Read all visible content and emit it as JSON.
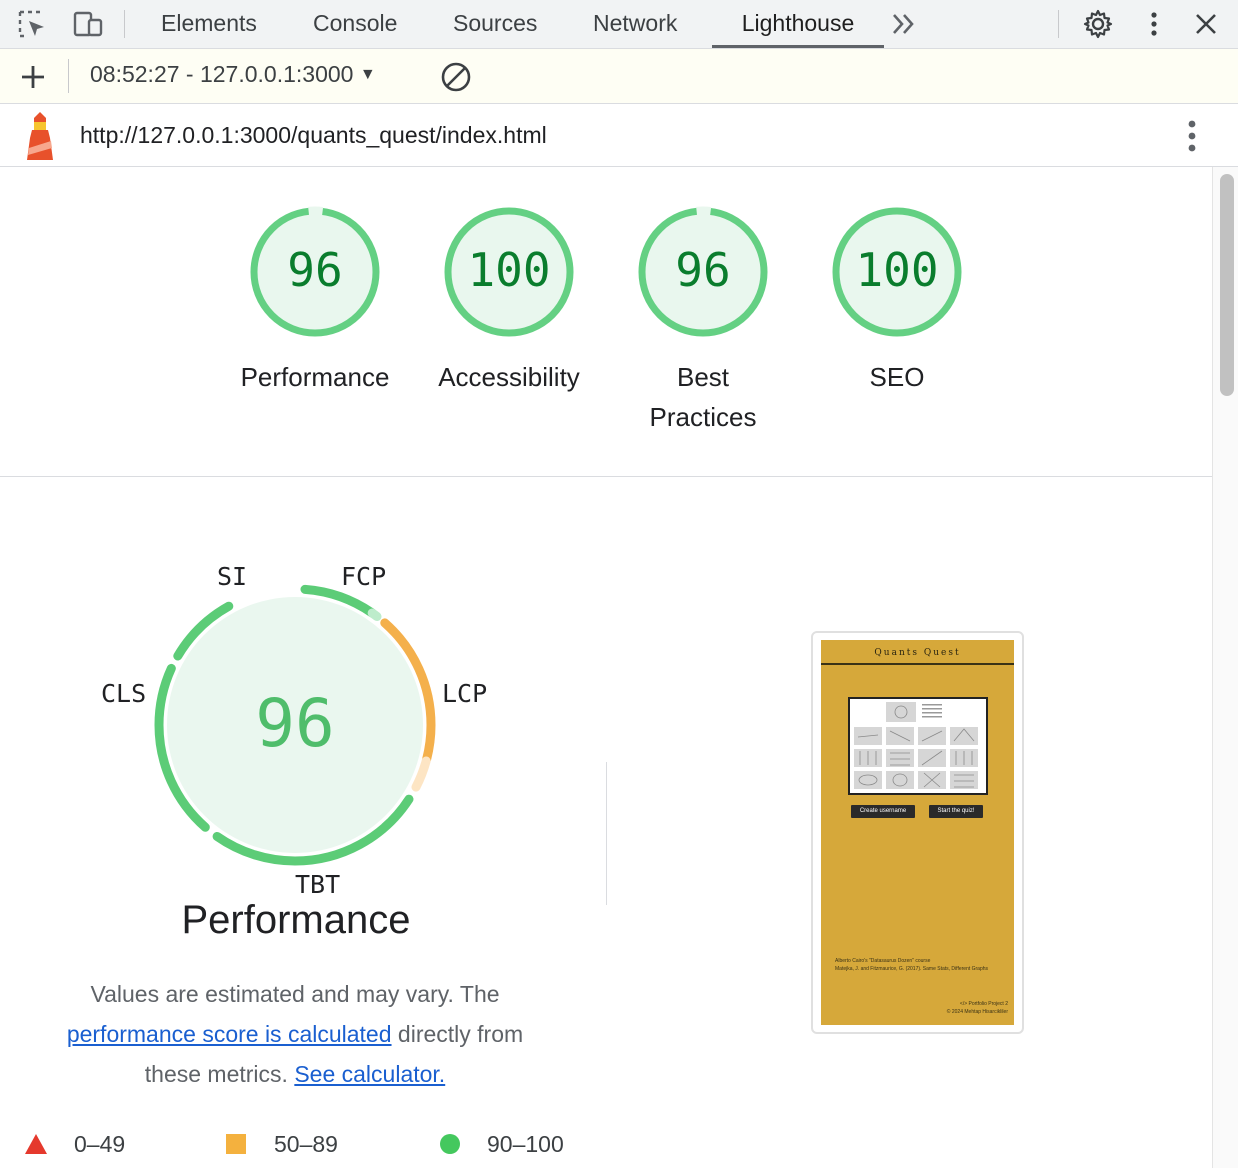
{
  "devtools": {
    "tabs": [
      {
        "label": "Elements"
      },
      {
        "label": "Console"
      },
      {
        "label": "Sources"
      },
      {
        "label": "Network"
      },
      {
        "label": "Lighthouse",
        "active": true
      }
    ]
  },
  "toolbar": {
    "report_selector": "08:52:27 - 127.0.0.1:3000"
  },
  "report": {
    "url": "http://127.0.0.1:3000/quants_quest/index.html"
  },
  "gauges": [
    {
      "label": "Performance",
      "score": "96"
    },
    {
      "label": "Accessibility",
      "score": "100"
    },
    {
      "label": "Best Practices",
      "score": "96"
    },
    {
      "label": "SEO",
      "score": "100"
    }
  ],
  "performance": {
    "score": "96",
    "title": "Performance",
    "metrics": {
      "si": "SI",
      "fcp": "FCP",
      "lcp": "LCP",
      "tbt": "TBT",
      "cls": "CLS"
    },
    "desc_part1": "Values are estimated and may vary. The",
    "desc_link1": "performance score is calculated",
    "desc_part2": "directly from",
    "desc_part3": "these metrics.",
    "desc_link2": "See calculator."
  },
  "screenshot": {
    "title": "Quants Quest",
    "button1": "Create username",
    "button2": "Start the quiz!",
    "footer1": "Alberto Cairo's \"Datasaurus Dozen\" course",
    "footer2": "Matejka, J. and Fitzmaurice, G. (2017). Same Stats, Different Graphs",
    "footer3": "</> Portfolio Project 2",
    "footer4": "© 2024 Mehtap Hisarcikliler"
  },
  "legend": {
    "fail": "0–49",
    "average": "50–89",
    "pass": "90–100"
  },
  "colors": {
    "pass": "#0cce6b",
    "pass_text": "#0a7d2d",
    "average": "#f4b13e",
    "fail": "#e5392d"
  }
}
